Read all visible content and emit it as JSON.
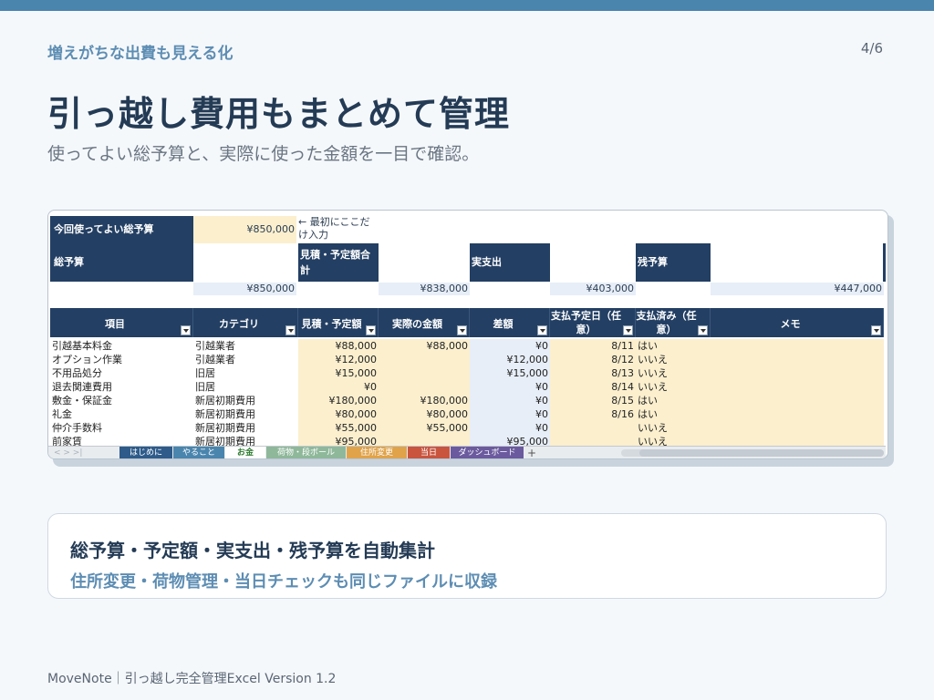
{
  "header": {
    "eyebrow": "増えがちな出費も見える化",
    "page": "4/6",
    "title": "引っ越し費用もまとめて管理",
    "subtitle": "使ってよい総予算と、実際に使った金額を一目で確認。"
  },
  "sheet": {
    "budget_label": "今回使ってよい総予算",
    "budget_value": "¥850,000",
    "note": "← 最初にここだけ入力",
    "total_label": "総予算",
    "total_value": "¥850,000",
    "estimate_label": "見積・予定額合計",
    "estimate_value": "¥838,000",
    "actual_label": "実支出",
    "actual_value": "¥403,000",
    "remaining_label": "残予算",
    "remaining_value": "¥447,000",
    "columns": [
      "項目",
      "カテゴリ",
      "見積・予定額",
      "実際の金額",
      "差額",
      "支払予定日（任意）",
      "支払済み（任意）",
      "メモ"
    ],
    "rows": [
      {
        "item": "引越基本料金",
        "category": "引越業者",
        "estimate": "¥88,000",
        "actual": "¥88,000",
        "diff": "¥0",
        "date": "8/11",
        "paid": "はい"
      },
      {
        "item": "オプション作業",
        "category": "引越業者",
        "estimate": "¥12,000",
        "actual": "",
        "diff": "¥12,000",
        "date": "8/12",
        "paid": "いいえ"
      },
      {
        "item": "不用品処分",
        "category": "旧居",
        "estimate": "¥15,000",
        "actual": "",
        "diff": "¥15,000",
        "date": "8/13",
        "paid": "いいえ"
      },
      {
        "item": "退去関連費用",
        "category": "旧居",
        "estimate": "¥0",
        "actual": "",
        "diff": "¥0",
        "date": "8/14",
        "paid": "いいえ"
      },
      {
        "item": "敷金・保証金",
        "category": "新居初期費用",
        "estimate": "¥180,000",
        "actual": "¥180,000",
        "diff": "¥0",
        "date": "8/15",
        "paid": "はい"
      },
      {
        "item": "礼金",
        "category": "新居初期費用",
        "estimate": "¥80,000",
        "actual": "¥80,000",
        "diff": "¥0",
        "date": "8/16",
        "paid": "はい"
      },
      {
        "item": "仲介手数料",
        "category": "新居初期費用",
        "estimate": "¥55,000",
        "actual": "¥55,000",
        "diff": "¥0",
        "date": "",
        "paid": "いいえ"
      },
      {
        "item": "前家賃",
        "category": "新居初期費用",
        "estimate": "¥95,000",
        "actual": "",
        "diff": "¥95,000",
        "date": "",
        "paid": "いいえ"
      }
    ],
    "tabs": [
      {
        "label": "はじめに",
        "color": "#2e5b8a"
      },
      {
        "label": "やること",
        "color": "#4a85ae"
      },
      {
        "label": "お金",
        "color": "#ffffff"
      },
      {
        "label": "荷物・段ボール",
        "color": "#8fb89a"
      },
      {
        "label": "住所変更",
        "color": "#e0a34a"
      },
      {
        "label": "当日",
        "color": "#c9553f"
      },
      {
        "label": "ダッシュボード",
        "color": "#6b5a9e"
      }
    ],
    "add_sheet": "+"
  },
  "feature": {
    "heading": "総予算・予定額・実支出・残予算を自動集計",
    "sub": "住所変更・荷物管理・当日チェックも同じファイルに収録"
  },
  "footer": "MoveNote｜引っ越し完全管理Excel  Version 1.2",
  "colors": {
    "accent": "#4a85ae",
    "navy": "#233f63",
    "cream": "#fbefce"
  }
}
